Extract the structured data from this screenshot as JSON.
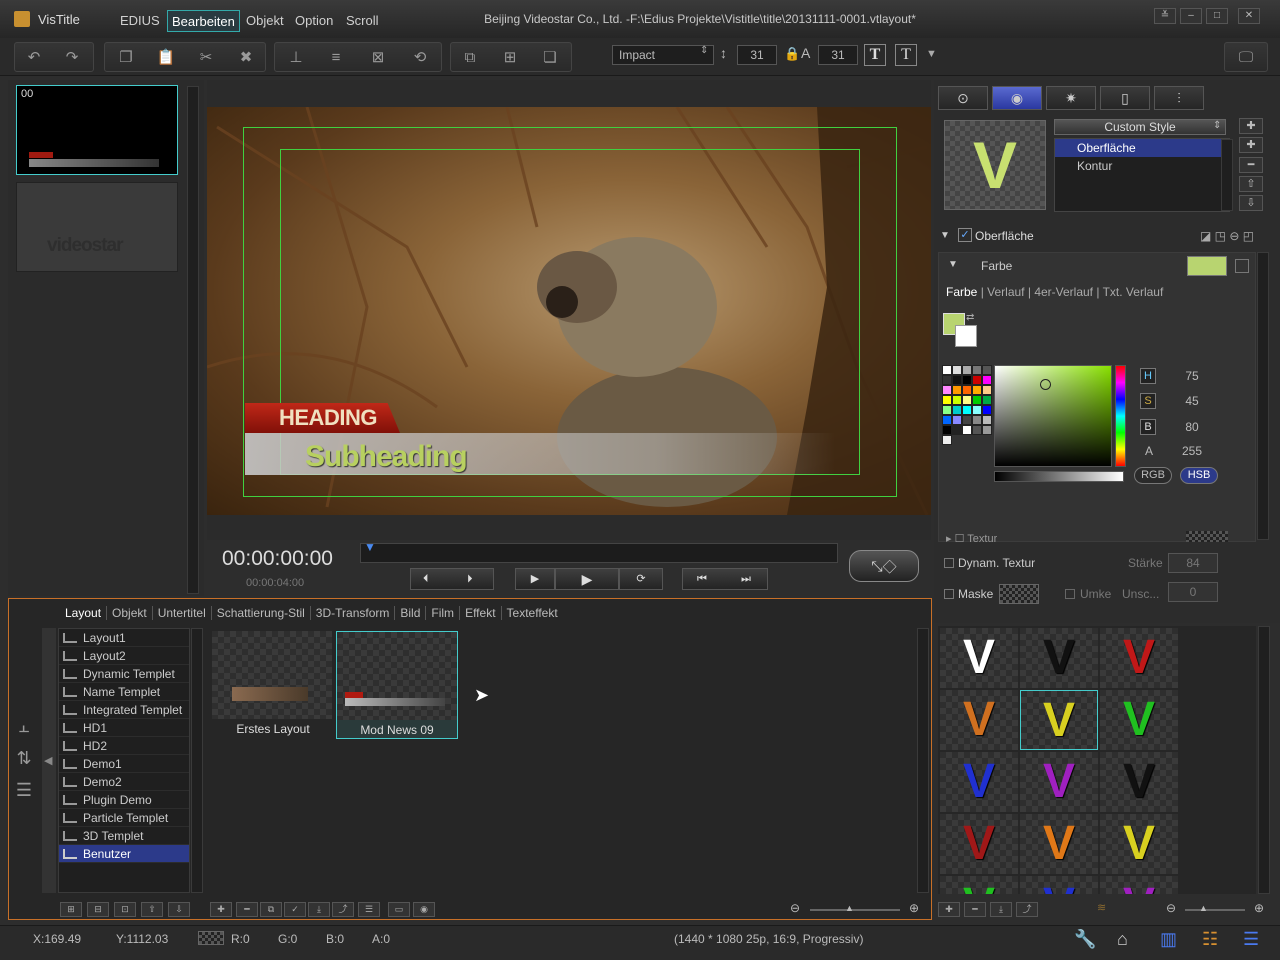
{
  "app": {
    "name": "VisTitle",
    "window_title": "Beijing Videostar Co., Ltd. -F:\\Edius Projekte\\Vistitle\\title\\20131111-0001.vtlayout*"
  },
  "menu": [
    "EDIUS",
    "Bearbeiten",
    "Objekt",
    "Option",
    "Scroll"
  ],
  "menu_active": "Bearbeiten",
  "toolbar": {
    "font": "Impact",
    "size1": "31",
    "size2": "31"
  },
  "thumbs": {
    "first_label": "00",
    "second_logo": "videostar"
  },
  "video": {
    "heading": "HEADING",
    "subheading": "Subheading"
  },
  "transport": {
    "timecode": "00:00:00:00",
    "duration": "00:00:04:00"
  },
  "bottom_tabs": [
    "Layout",
    "Objekt",
    "Untertitel",
    "Schattierung-Stil",
    "3D-Transform",
    "Bild",
    "Film",
    "Effekt",
    "Texteffekt"
  ],
  "layouts": [
    "Layout1",
    "Layout2",
    "Dynamic Templet",
    "Name Templet",
    "Integrated Templet",
    "HD1",
    "HD2",
    "Demo1",
    "Demo2",
    "Plugin Demo",
    "Particle Templet",
    "3D Templet",
    "Benutzer"
  ],
  "layouts_selected": "Benutzer",
  "gallery": [
    {
      "label": "Erstes Layout"
    },
    {
      "label": "Mod News 09"
    }
  ],
  "style": {
    "preview_letter": "V",
    "selector": "Custom Style",
    "items": [
      "Oberfläche",
      "Kontur"
    ],
    "selected": "Oberfläche"
  },
  "surface": {
    "section": "Oberfläche",
    "color_label": "Farbe",
    "subtabs": [
      "Farbe",
      "Verlauf",
      "4er-Verlauf",
      "Txt. Verlauf"
    ],
    "texture": "Textur",
    "color_hex": "#b8d470"
  },
  "hsb": {
    "H": "75",
    "S": "45",
    "B": "80",
    "A": "255",
    "btn_rgb": "RGB",
    "btn_hsb": "HSB"
  },
  "options": {
    "dyn_texture": "Dynam. Textur",
    "strength_label": "Stärke",
    "strength_value": "84",
    "mask": "Maske",
    "invert": "Umke",
    "blur": "Unsc...",
    "blur_value": "0"
  },
  "presets": [
    {
      "letter": "V",
      "color": "#ffffff"
    },
    {
      "letter": "V",
      "color": "#111111"
    },
    {
      "letter": "V",
      "color": "#c01818"
    },
    {
      "letter": "V",
      "color": "#d07020"
    },
    {
      "letter": "V",
      "color": "#d8d020"
    },
    {
      "letter": "V",
      "color": "#20c020"
    },
    {
      "letter": "V",
      "color": "#2030d0"
    },
    {
      "letter": "V",
      "color": "#a020c0"
    },
    {
      "letter": "V",
      "color": "#111111"
    },
    {
      "letter": "V",
      "color": "#a01818"
    },
    {
      "letter": "V",
      "color": "#e07818"
    },
    {
      "letter": "V",
      "color": "#d8d020"
    },
    {
      "letter": "V",
      "color": "#20c020"
    },
    {
      "letter": "V",
      "color": "#2030d0"
    },
    {
      "letter": "V",
      "color": "#a020c0"
    }
  ],
  "status": {
    "x": "X:169.49",
    "y": "Y:1112.03",
    "r": "R:0",
    "g": "G:0",
    "b": "B:0",
    "a": "A:0",
    "format": "(1440 * 1080 25p, 16:9, Progressiv)"
  }
}
